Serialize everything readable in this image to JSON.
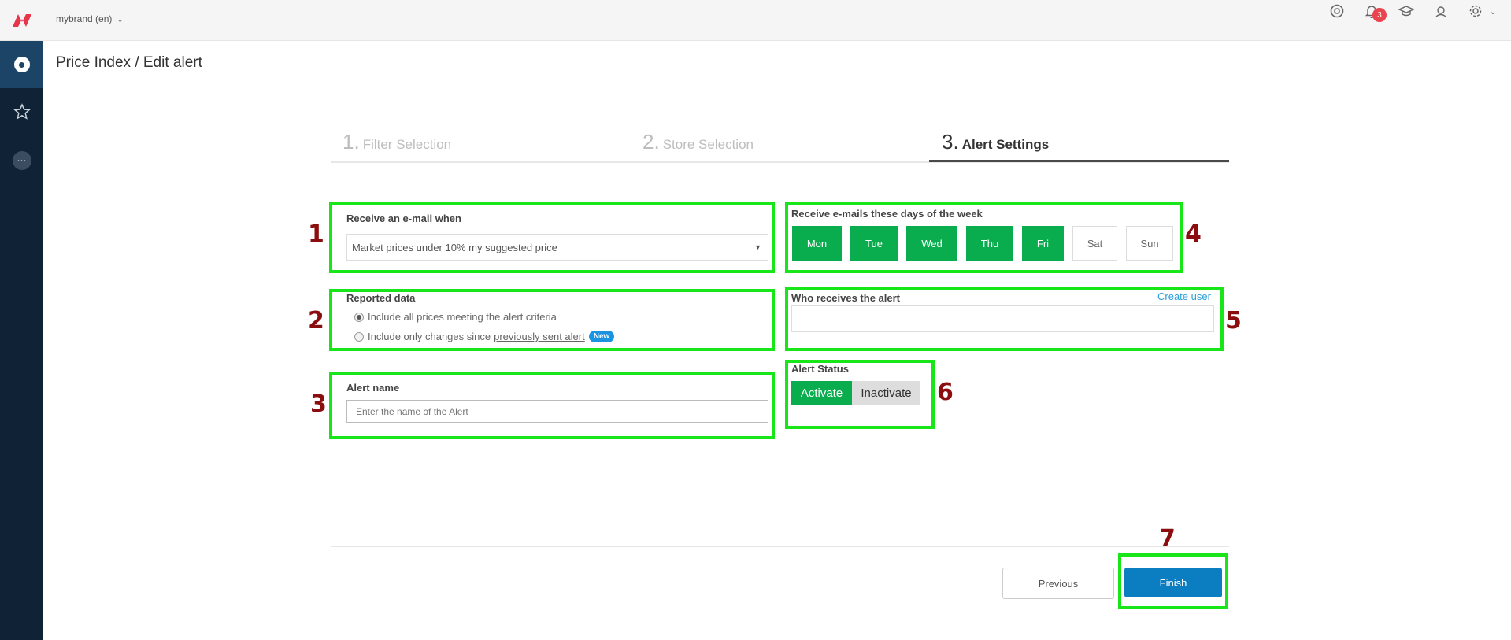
{
  "header": {
    "brand_selector": "mybrand (en)",
    "notification_count": "3",
    "brand_color": "#e8354a"
  },
  "page": {
    "title": "Price Index / Edit alert"
  },
  "steps": [
    {
      "num": "1.",
      "label": "Filter Selection",
      "active": false
    },
    {
      "num": "2.",
      "label": "Store Selection",
      "active": false
    },
    {
      "num": "3.",
      "label": "Alert Settings",
      "active": true
    }
  ],
  "email_trigger": {
    "label": "Receive an e-mail when",
    "selected": "Market prices under 10% my suggested price"
  },
  "reported_data": {
    "label": "Reported data",
    "option_all": "Include all prices meeting the alert criteria",
    "option_changes_prefix": "Include only changes since",
    "option_changes_link": "previously sent alert",
    "new_badge": "New",
    "selected": "all"
  },
  "alert_name": {
    "label": "Alert name",
    "placeholder": "Enter the name of the Alert"
  },
  "days": {
    "label": "Receive e-mails these days of the week",
    "items": [
      {
        "label": "Mon",
        "on": true
      },
      {
        "label": "Tue",
        "on": true
      },
      {
        "label": "Wed",
        "on": true
      },
      {
        "label": "Thu",
        "on": true
      },
      {
        "label": "Fri",
        "on": true
      },
      {
        "label": "Sat",
        "on": false
      },
      {
        "label": "Sun",
        "on": false
      }
    ]
  },
  "recipients": {
    "label": "Who receives the alert",
    "create_user": "Create user"
  },
  "status": {
    "label": "Alert Status",
    "activate": "Activate",
    "inactivate": "Inactivate",
    "selected": "Activate"
  },
  "footer": {
    "previous": "Previous",
    "finish": "Finish"
  },
  "annotations": {
    "m1": "1",
    "m2": "2",
    "m3": "3",
    "m4": "4",
    "m5": "5",
    "m6": "6",
    "m7": "7",
    "highlight_color": "#19e619",
    "marker_color": "#8b0d0d"
  }
}
